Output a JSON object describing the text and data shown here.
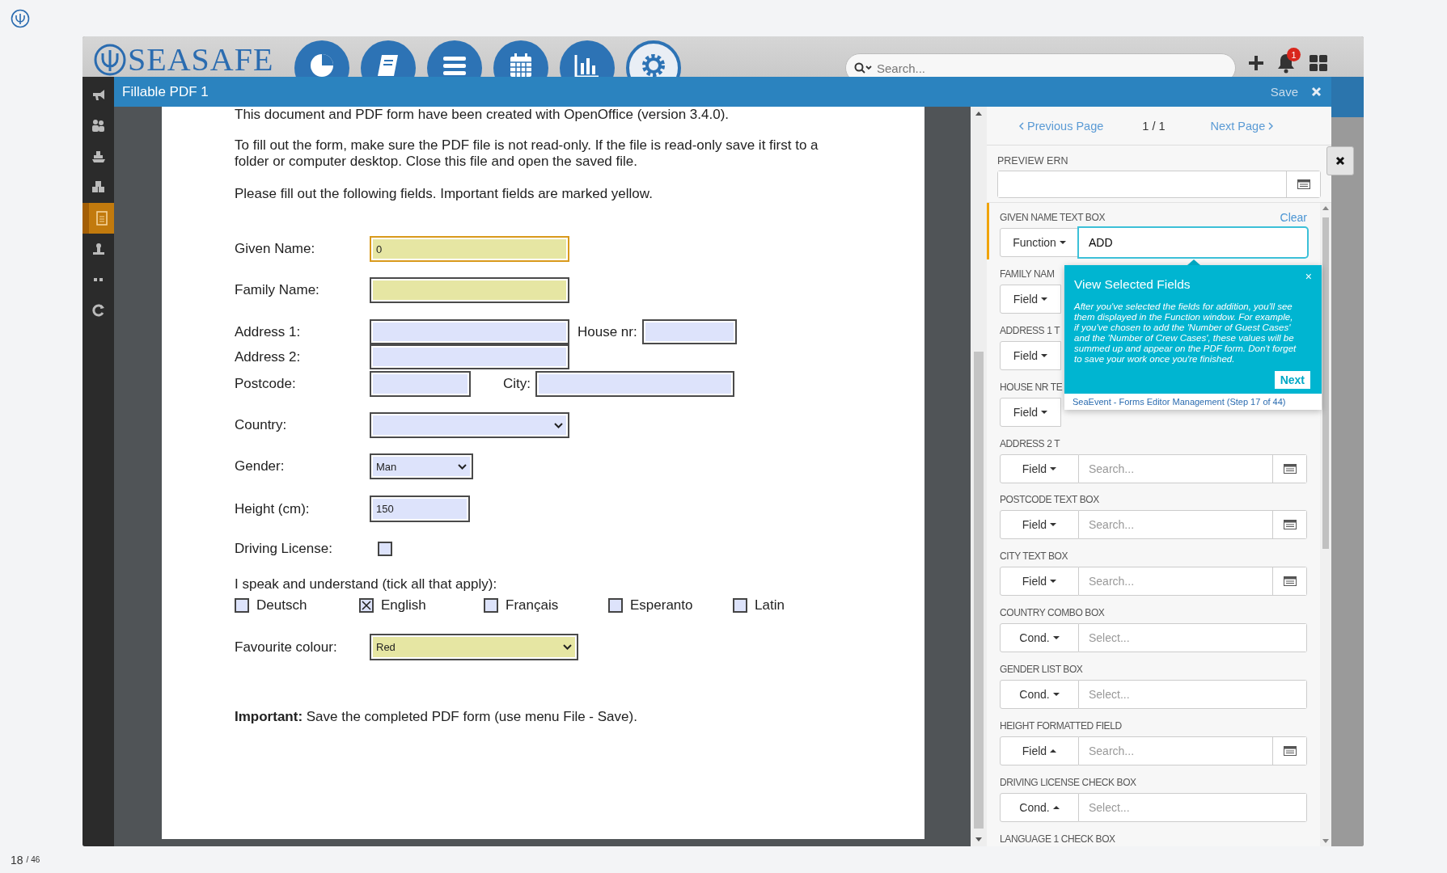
{
  "app": {
    "brand": "SEASAFE",
    "search": {
      "placeholder": "Search..."
    },
    "notifications": "1"
  },
  "sidebar": {
    "items": [
      {
        "selected": false
      },
      {
        "selected": false
      },
      {
        "selected": false
      },
      {
        "selected": false
      },
      {
        "selected": true
      },
      {
        "selected": false
      },
      {
        "selected": false
      },
      {
        "selected": false
      }
    ]
  },
  "modal": {
    "title": "Fillable PDF 1",
    "save": "Save"
  },
  "pdf": {
    "intro": [
      "This document and PDF form have been created with OpenOffice (version 3.4.0).",
      "To fill out the form, make sure the PDF file is not read-only. If the file is read-only save it first to a folder or computer desktop. Close this file and open the saved file.",
      "Please fill out the following fields. Important fields are marked yellow."
    ],
    "given_name": {
      "label": "Given Name:",
      "value": "0",
      "required": true,
      "focused": true
    },
    "family_name": {
      "label": "Family Name:",
      "required": true,
      "focused": false
    },
    "address_1": {
      "label": "Address 1:",
      "required": false
    },
    "house_nr": {
      "label": "House nr:",
      "required": false
    },
    "address_2": {
      "label": "Address 2:",
      "required": false
    },
    "postcode": {
      "label": "Postcode:",
      "required": false
    },
    "city": {
      "label": "City:",
      "required": false
    },
    "country": {
      "label": "Country:",
      "required": false
    },
    "gender": {
      "label": "Gender:",
      "value": "Man",
      "required": false
    },
    "height": {
      "label": "Height (cm):",
      "value": "150",
      "required": false
    },
    "driving_license": {
      "label": "Driving License:",
      "checked": false
    },
    "languages_prompt": "I speak and understand (tick all that apply):",
    "languages": [
      {
        "label": "Deutsch",
        "checked": false
      },
      {
        "label": "English",
        "checked": true
      },
      {
        "label": "Français",
        "checked": false
      },
      {
        "label": "Esperanto",
        "checked": false
      },
      {
        "label": "Latin",
        "checked": false
      }
    ],
    "favourite_colour": {
      "label": "Favourite colour:",
      "value": "Red",
      "required": true
    },
    "note": "**Important:** Save the completed PDF form (use menu File - Save)."
  },
  "panel": {
    "pager": {
      "previous": "Previous Page",
      "current": "1 / 1",
      "next": "Next Page"
    },
    "preview": {
      "label": "PREVIEW ERN"
    },
    "mappings": [
      {
        "label": "GIVEN NAME TEXT BOX",
        "mode": "Function",
        "expanded": false,
        "value": "ADD",
        "picker": false,
        "active": true,
        "action": "Clear"
      },
      {
        "label": "FAMILY NAM",
        "mode": "Field",
        "expanded": false,
        "active": false
      },
      {
        "label": "ADDRESS 1 T",
        "mode": "Field",
        "expanded": false,
        "active": false
      },
      {
        "label": "HOUSE NR TE",
        "mode": "Field",
        "expanded": false,
        "active": false
      },
      {
        "label": "ADDRESS 2 T",
        "mode": "Field",
        "expanded": false,
        "placeholder": "Search...",
        "picker": true,
        "active": false
      },
      {
        "label": "POSTCODE TEXT BOX",
        "mode": "Field",
        "expanded": false,
        "placeholder": "Search...",
        "picker": true,
        "active": false
      },
      {
        "label": "CITY TEXT BOX",
        "mode": "Field",
        "expanded": false,
        "placeholder": "Search...",
        "picker": true,
        "active": false
      },
      {
        "label": "COUNTRY COMBO BOX",
        "mode": "Cond.",
        "expanded": false,
        "placeholder": "Select...",
        "picker": false,
        "active": false
      },
      {
        "label": "GENDER LIST BOX",
        "mode": "Cond.",
        "expanded": false,
        "placeholder": "Select...",
        "picker": false,
        "active": false
      },
      {
        "label": "HEIGHT FORMATTED FIELD",
        "mode": "Field",
        "expanded": true,
        "placeholder": "Search...",
        "picker": true,
        "active": false
      },
      {
        "label": "DRIVING LICENSE CHECK BOX",
        "mode": "Cond.",
        "expanded": true,
        "placeholder": "Select...",
        "picker": false,
        "active": false
      },
      {
        "label": "LANGUAGE 1 CHECK BOX"
      }
    ]
  },
  "tooltip": {
    "close": "×",
    "title": "View Selected Fields",
    "body": "After you've selected the fields for addition, you'll see them displayed in the Function window. For example, if you've chosen to add the 'Number of Guest Cases' and the 'Number of Crew Cases', these values will be summed up and appear on the PDF form. Don't forget to save your work once you're finished.",
    "button": "Next",
    "footer": "SeaEvent - Forms Editor Management (Step 17 of 44)"
  },
  "footer": {
    "page": "18",
    "total": "/ 46"
  }
}
